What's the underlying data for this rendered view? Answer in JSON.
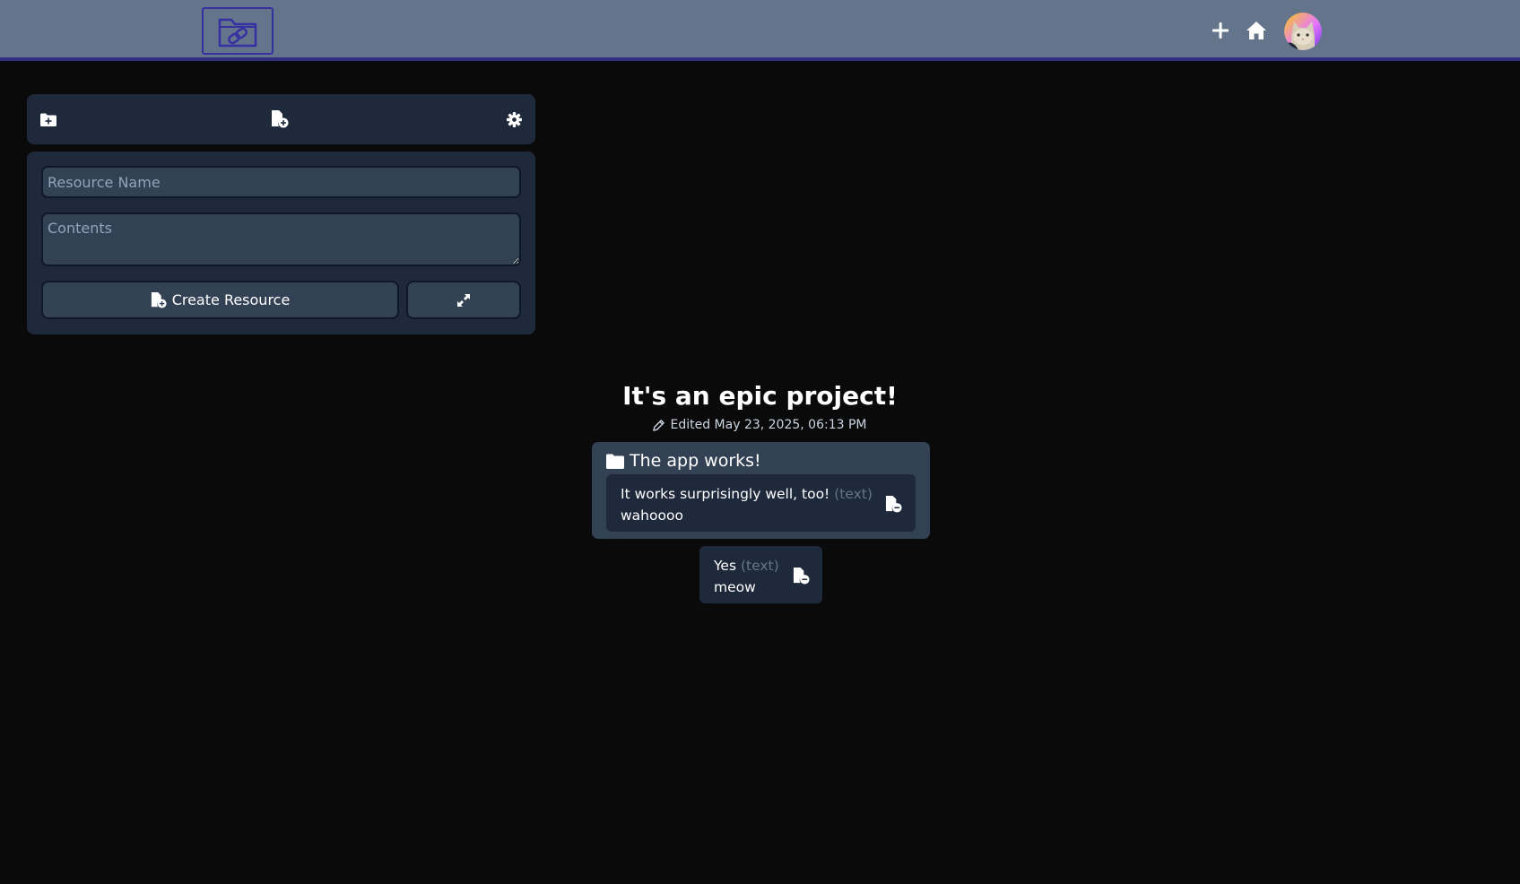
{
  "nav": {
    "logo_icon": "folder-link-icon",
    "add_icon": "plus-icon",
    "home_icon": "home-icon",
    "avatar_icon": "cat-avatar"
  },
  "toolbar": {
    "add_folder_icon": "folder-plus-icon",
    "add_resource_icon": "file-circle-plus-icon",
    "settings_icon": "gear-icon"
  },
  "form": {
    "name_placeholder": "Resource Name",
    "name_value": "",
    "contents_placeholder": "Contents",
    "contents_value": "",
    "create_label": "Create Resource",
    "expand_icon": "expand-icon"
  },
  "project": {
    "title": "It's an epic project!",
    "edited": "Edited May 23, 2025, 06:13 PM"
  },
  "folder": {
    "title": "The app works!",
    "resource": {
      "name": "It works surprisingly well, too!",
      "type": "(text)",
      "contents": "wahoooo"
    }
  },
  "resource": {
    "name": "Yes",
    "type": "(text)",
    "contents": "meow"
  },
  "colors": {
    "background": "#0a0a0b",
    "navbar": "#64748b",
    "navbar_border": "#312e81",
    "panel": "#1e293b",
    "field": "#334155",
    "muted_text": "#64748b"
  }
}
